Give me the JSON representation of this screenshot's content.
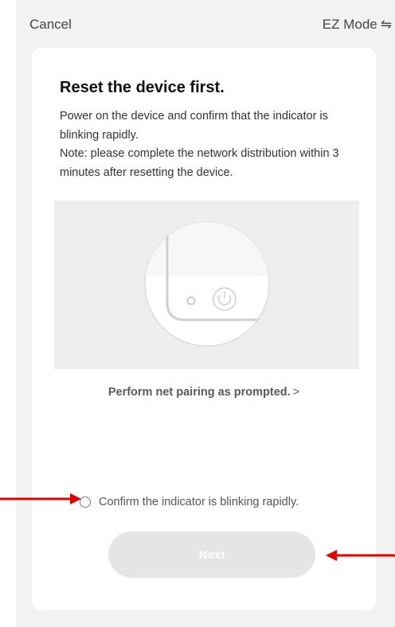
{
  "topbar": {
    "cancel_label": "Cancel",
    "mode_label": "EZ Mode",
    "mode_icon": "⇋"
  },
  "card": {
    "title": "Reset the device first.",
    "description_lines": [
      "Power on the device and confirm that the indicator is blinking rapidly.",
      "Note: please complete the network distribution within 3 minutes after resetting the device."
    ],
    "illustration_icon": "device-power-button-illustration",
    "pairing_link": "Perform net pairing as prompted.",
    "pairing_chevron": ">",
    "confirm_label": "Confirm the indicator is blinking rapidly.",
    "confirm_checked": false,
    "next_label": "Next",
    "next_enabled": false
  },
  "colors": {
    "screen_background": "#f2f2f2",
    "card_background": "#ffffff",
    "disabled_button": "#e5e5e5",
    "annotation_arrow": "#e00000"
  }
}
